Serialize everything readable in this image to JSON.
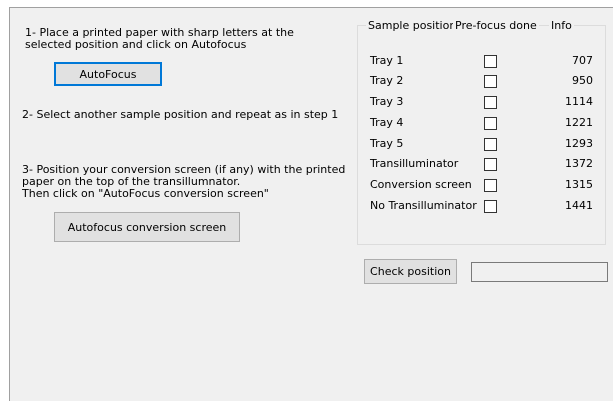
{
  "steps": {
    "step1": "1- Place a printed paper with sharp letters at the selected position and click on Autofocus",
    "autofocus_button": "AutoFocus",
    "step2": "2- Select another sample position and repeat as in step 1",
    "step3_line1": "3- Position your conversion screen (if any) with the printed",
    "step3_line2": "paper on the top of the transillumnator.",
    "step3_line3": "Then click on \"AutoFocus conversion screen\"",
    "autofocus_conversion_button": "Autofocus conversion screen"
  },
  "table": {
    "header_position": "Sample position",
    "header_prefocus": "Pre-focus done",
    "header_info": "Info",
    "rows": [
      {
        "label": "Tray 1",
        "checked": false,
        "info": "707"
      },
      {
        "label": "Tray 2",
        "checked": false,
        "info": "950"
      },
      {
        "label": "Tray 3",
        "checked": false,
        "info": "1114"
      },
      {
        "label": "Tray 4",
        "checked": false,
        "info": "1221"
      },
      {
        "label": "Tray 5",
        "checked": false,
        "info": "1293"
      },
      {
        "label": "Transilluminator",
        "checked": false,
        "info": "1372"
      },
      {
        "label": "Conversion screen",
        "checked": false,
        "info": "1315"
      },
      {
        "label": "No Transilluminator",
        "checked": false,
        "info": "1441"
      }
    ]
  },
  "check_position": {
    "button_label": "Check position",
    "result_value": ""
  },
  "colors": {
    "panel_bg": "#f0f0f0",
    "focus_border": "#0078d7"
  }
}
